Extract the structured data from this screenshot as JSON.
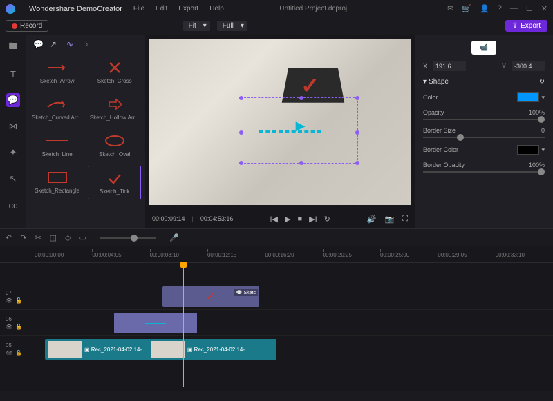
{
  "app": {
    "name": "Wondershare DemoCreator",
    "project": "Untitled Project.dcproj"
  },
  "menu": {
    "file": "File",
    "edit": "Edit",
    "export": "Export",
    "help": "Help"
  },
  "toolbar": {
    "record": "Record",
    "fit": "Fit",
    "full": "Full",
    "export": "Export"
  },
  "assets": {
    "items": [
      {
        "label": "Sketch_Arrow"
      },
      {
        "label": "Sketch_Cross"
      },
      {
        "label": "Sketch_Curved Arr..."
      },
      {
        "label": "Sketch_Hollow Arr..."
      },
      {
        "label": "Sketch_Line"
      },
      {
        "label": "Sketch_Oval"
      },
      {
        "label": "Sketch_Rectangle"
      },
      {
        "label": "Sketch_Tick"
      }
    ]
  },
  "player": {
    "current": "00:00:09:14",
    "total": "00:04:53:16"
  },
  "props": {
    "x_label": "X",
    "x": "191.6",
    "y_label": "Y",
    "y": "-300.4",
    "section": "Shape",
    "color_label": "Color",
    "color": "#0095ff",
    "opacity_label": "Opacity",
    "opacity": "100%",
    "border_size_label": "Border Size",
    "border_size": "0",
    "border_color_label": "Border Color",
    "border_opacity_label": "Border Opacity",
    "border_opacity": "100%"
  },
  "timeline": {
    "ticks": [
      "00:00:00:00",
      "00:00:04:05",
      "00:00:08:10",
      "00:00:12:15",
      "00:00:16:20",
      "00:00:20:25",
      "00:00:25:00",
      "00:00:29:05",
      "00:00:33:10"
    ],
    "tracks": {
      "t07": "07",
      "t06": "06",
      "t05": "05"
    },
    "clips": {
      "sketch": "Sketc",
      "video1": "Rec_2021-04-02 14-...",
      "video2": "Rec_2021-04-02 14-..."
    }
  }
}
